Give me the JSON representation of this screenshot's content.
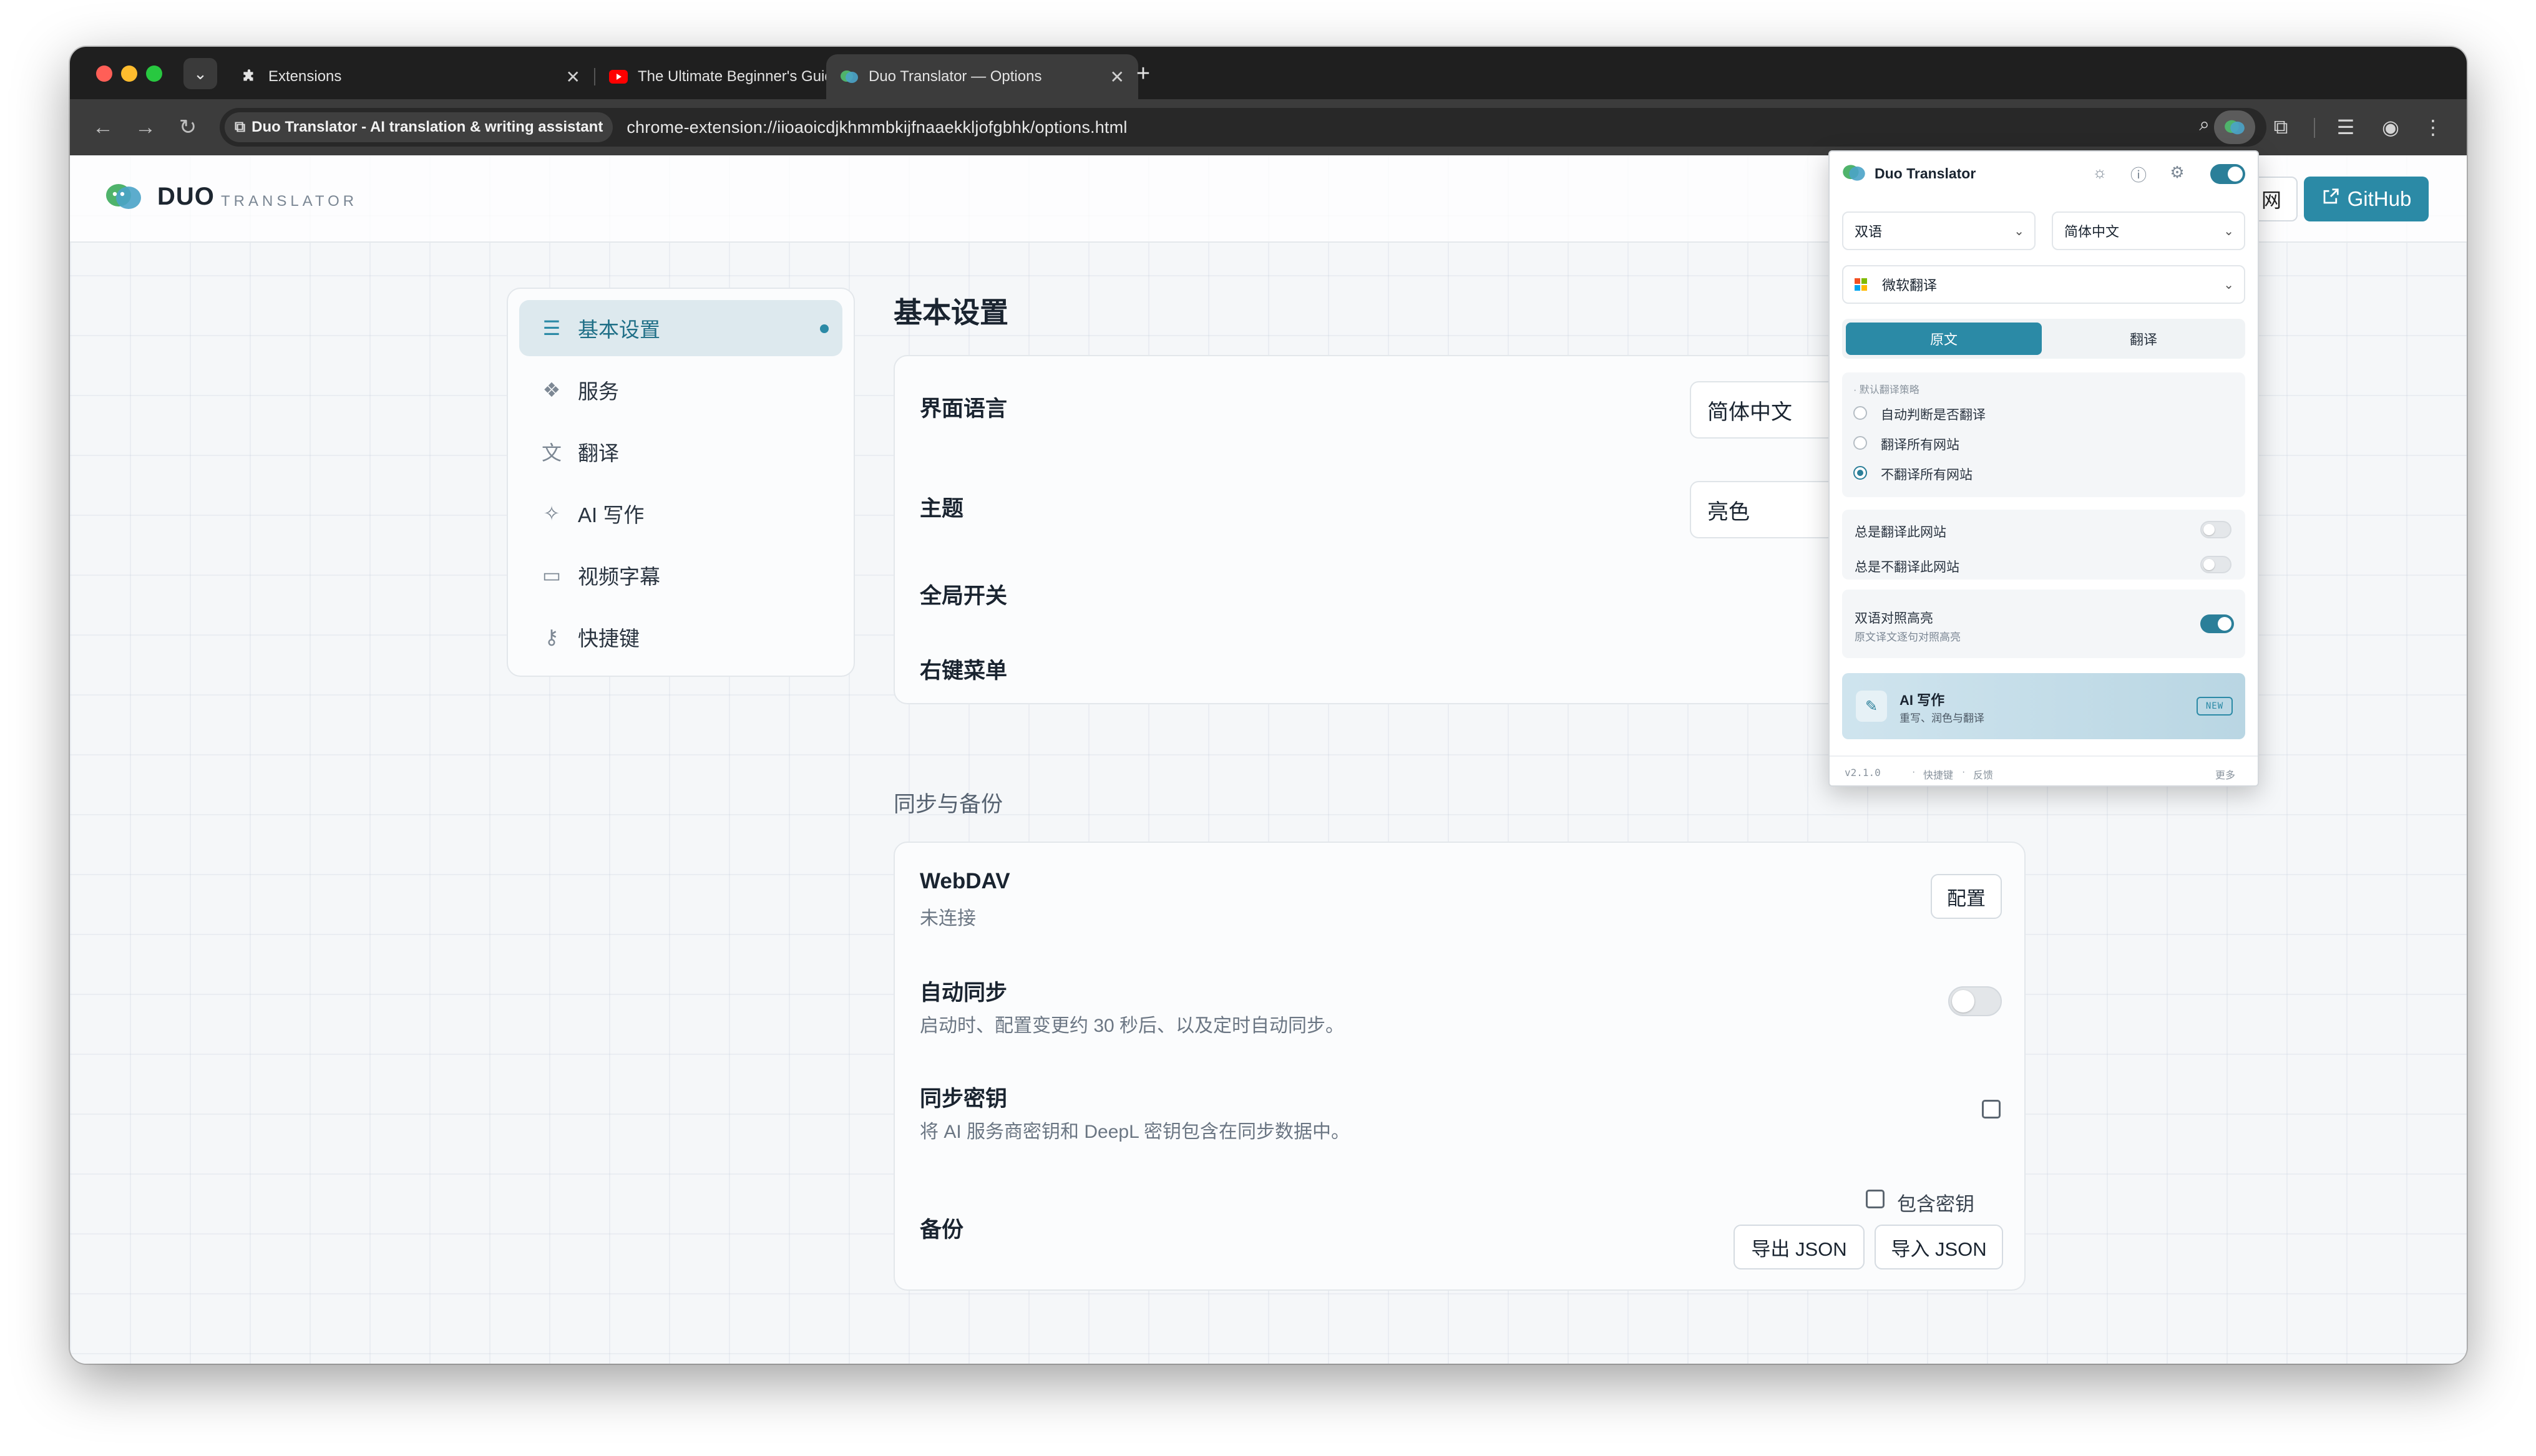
{
  "browser": {
    "tabs": [
      {
        "title": "Extensions",
        "icon": "puzzle-icon"
      },
      {
        "title": "The Ultimate Beginner's Guide",
        "icon": "youtube-icon"
      },
      {
        "title": "Duo Translator — Options",
        "icon": "duo-logo-icon"
      }
    ],
    "site_chip": "Duo Translator - AI translation & writing assistant",
    "url": "chrome-extension://iioaoicdjkhmmbkijfnaaekkljofgbhk/options.html"
  },
  "header": {
    "brand": "DUO",
    "brand_sub": "TRANSLATOR",
    "partial_button": "网",
    "github_button": "GitHub"
  },
  "sidebar": {
    "items": [
      {
        "label": "基本设置",
        "icon": "sliders-icon",
        "active": true
      },
      {
        "label": "服务",
        "icon": "services-icon"
      },
      {
        "label": "翻译",
        "icon": "translate-icon"
      },
      {
        "label": "AI 写作",
        "icon": "sparkle-icon"
      },
      {
        "label": "视频字幕",
        "icon": "subtitles-icon"
      },
      {
        "label": "快捷键",
        "icon": "key-icon"
      }
    ]
  },
  "basic": {
    "title": "基本设置",
    "ui_language_label": "界面语言",
    "ui_language_value": "简体中文",
    "theme_label": "主题",
    "theme_value": "亮色",
    "global_switch_label": "全局开关",
    "context_menu_label": "右键菜单"
  },
  "sync": {
    "title": "同步与备份",
    "webdav_title": "WebDAV",
    "webdav_status": "未连接",
    "config_button": "配置",
    "autosync_title": "自动同步",
    "autosync_desc": "启动时、配置变更约 30 秒后、以及定时自动同步。",
    "autosync_enabled": false,
    "synckey_title": "同步密钥",
    "synckey_desc": "将 AI 服务商密钥和 DeepL 密钥包含在同步数据中。",
    "synckey_checked": false,
    "backup_title": "备份",
    "include_keys_label": "包含密钥",
    "include_keys_checked": false,
    "export_button": "导出 JSON",
    "import_button": "导入 JSON"
  },
  "popup": {
    "title": "Duo Translator",
    "enabled": true,
    "mode_select": "双语",
    "target_lang_select": "简体中文",
    "service_select": "微软翻译",
    "seg_original": "原文",
    "seg_translation": "翻译",
    "seg_selected": "原文",
    "strategy_label": "· 默认翻译策略",
    "strategy_options": [
      "自动判断是否翻译",
      "翻译所有网站",
      "不翻译所有网站"
    ],
    "strategy_selected": "不翻译所有网站",
    "always_translate_label": "总是翻译此网站",
    "never_translate_label": "总是不翻译此网站",
    "bilingual_highlight_label": "双语对照高亮",
    "bilingual_highlight_desc": "原文译文逐句对照高亮",
    "bilingual_highlight_on": true,
    "ai_title": "AI 写作",
    "ai_desc": "重写、润色与翻译",
    "ai_badge": "NEW",
    "version": "v2.1.0",
    "footer_shortcuts": "快捷键",
    "footer_feedback": "反馈",
    "footer_more": "更多"
  },
  "colors": {
    "accent": "#2b8aa6",
    "tabstrip": "#1f1f1f",
    "toolbar": "#3c3c3c"
  }
}
